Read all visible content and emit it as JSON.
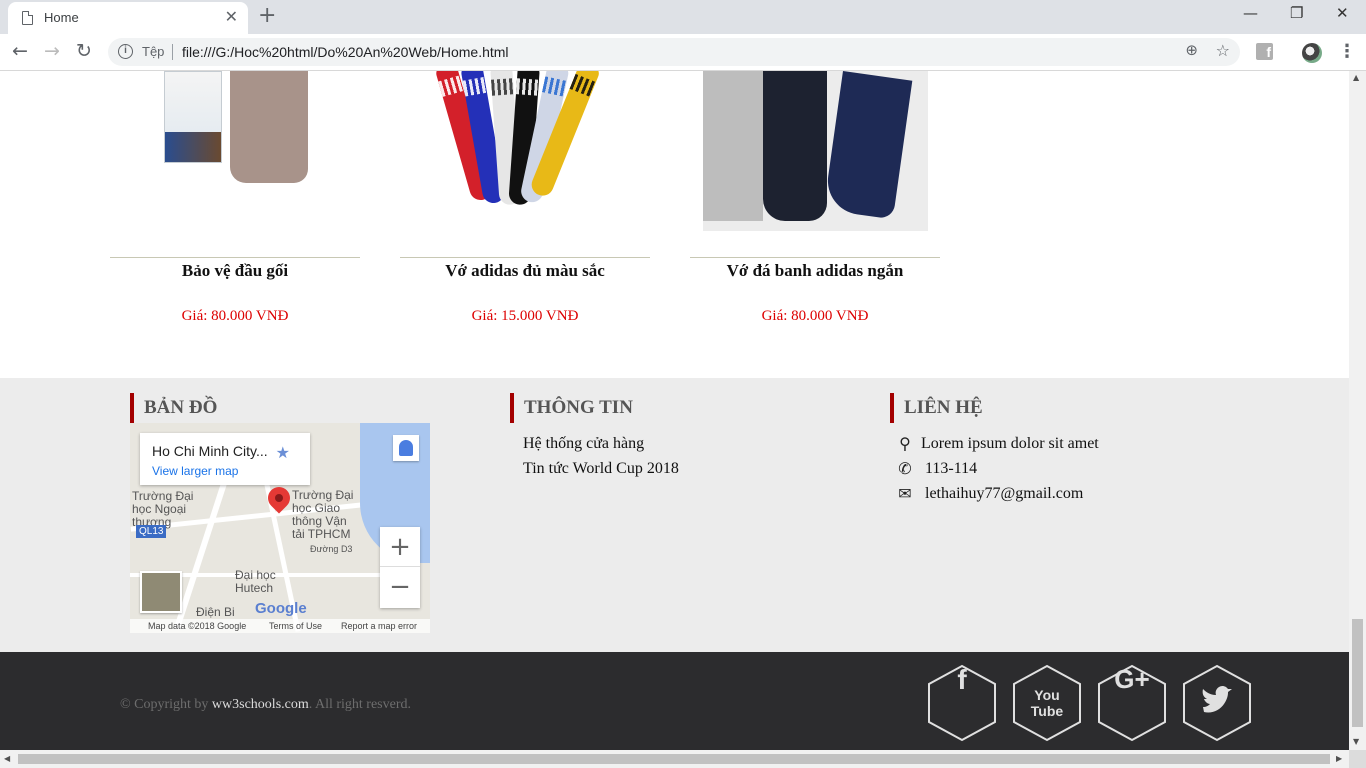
{
  "browser": {
    "tab_title": "Home",
    "tab_close": "✕",
    "new_tab": "+",
    "window_controls": {
      "minimize": "—",
      "restore": "❐",
      "close": "✕"
    },
    "nav": {
      "back": "←",
      "forward": "→",
      "reload": "↻"
    },
    "address_scheme_label": "Tệp",
    "address_url": "file:///G:/Hoc%20html/Do%20An%20Web/Home.html",
    "zoom_icon": "⊕",
    "bookmark_icon": "☆",
    "menu_icon": "⋮"
  },
  "products": [
    {
      "name": "Bảo vệ đầu gối",
      "price": "Giá: 80.000 VNĐ",
      "image": "knee-guard"
    },
    {
      "name": "Vớ adidas đủ màu sắc",
      "price": "Giá: 15.000 VNĐ",
      "image": "colored-socks"
    },
    {
      "name": "Vớ đá banh adidas ngắn",
      "price": "Giá: 80.000 VNĐ",
      "image": "short-socks"
    }
  ],
  "map_section": {
    "title": "BẢN ĐỒ",
    "place_name": "Ho Chi Minh City...",
    "larger_map_link": "View larger map",
    "zoom_in": "+",
    "zoom_out": "−",
    "labels": {
      "ngoai_thuong": "Trường Đại học Ngoại thương",
      "giao_thong": "Trường Đại học Giao thông Vận tải TPHCM",
      "hutech": "Đại học Hutech",
      "ql13": "QL13",
      "duong_d3": "Đường D3",
      "dien_bien": "Điện Bi"
    },
    "google_logo": "Google",
    "attribution": {
      "map_data": "Map data ©2018 Google",
      "terms": "Terms of Use",
      "report": "Report a map error"
    }
  },
  "info_section": {
    "title": "THÔNG TIN",
    "links": [
      "Hệ thống cửa hàng",
      "Tin tức World Cup 2018"
    ]
  },
  "contact_section": {
    "title": "LIÊN HỆ",
    "items": [
      {
        "icon": "map-marker-icon",
        "glyph": "⚲",
        "text": "Lorem ipsum dolor sit amet"
      },
      {
        "icon": "phone-icon",
        "glyph": "✆",
        "text": "113-114"
      },
      {
        "icon": "envelope-icon",
        "glyph": "✉",
        "text": "lethaihuy77@gmail.com"
      }
    ]
  },
  "footer": {
    "copyright_prefix": "© Copyright by ",
    "copyright_brand": "ww3schools.com",
    "copyright_suffix": ". All right resverd.",
    "social": [
      {
        "name": "facebook-icon",
        "glyph": "f"
      },
      {
        "name": "youtube-icon",
        "glyph": "You\nTube"
      },
      {
        "name": "google-plus-icon",
        "glyph": "G+"
      },
      {
        "name": "twitter-icon",
        "glyph": "🐦"
      }
    ]
  },
  "colors": {
    "accent_bar": "#a30000",
    "price": "#dd0000",
    "footer_bg": "#2c2c2e",
    "info_bg": "#ececec"
  }
}
